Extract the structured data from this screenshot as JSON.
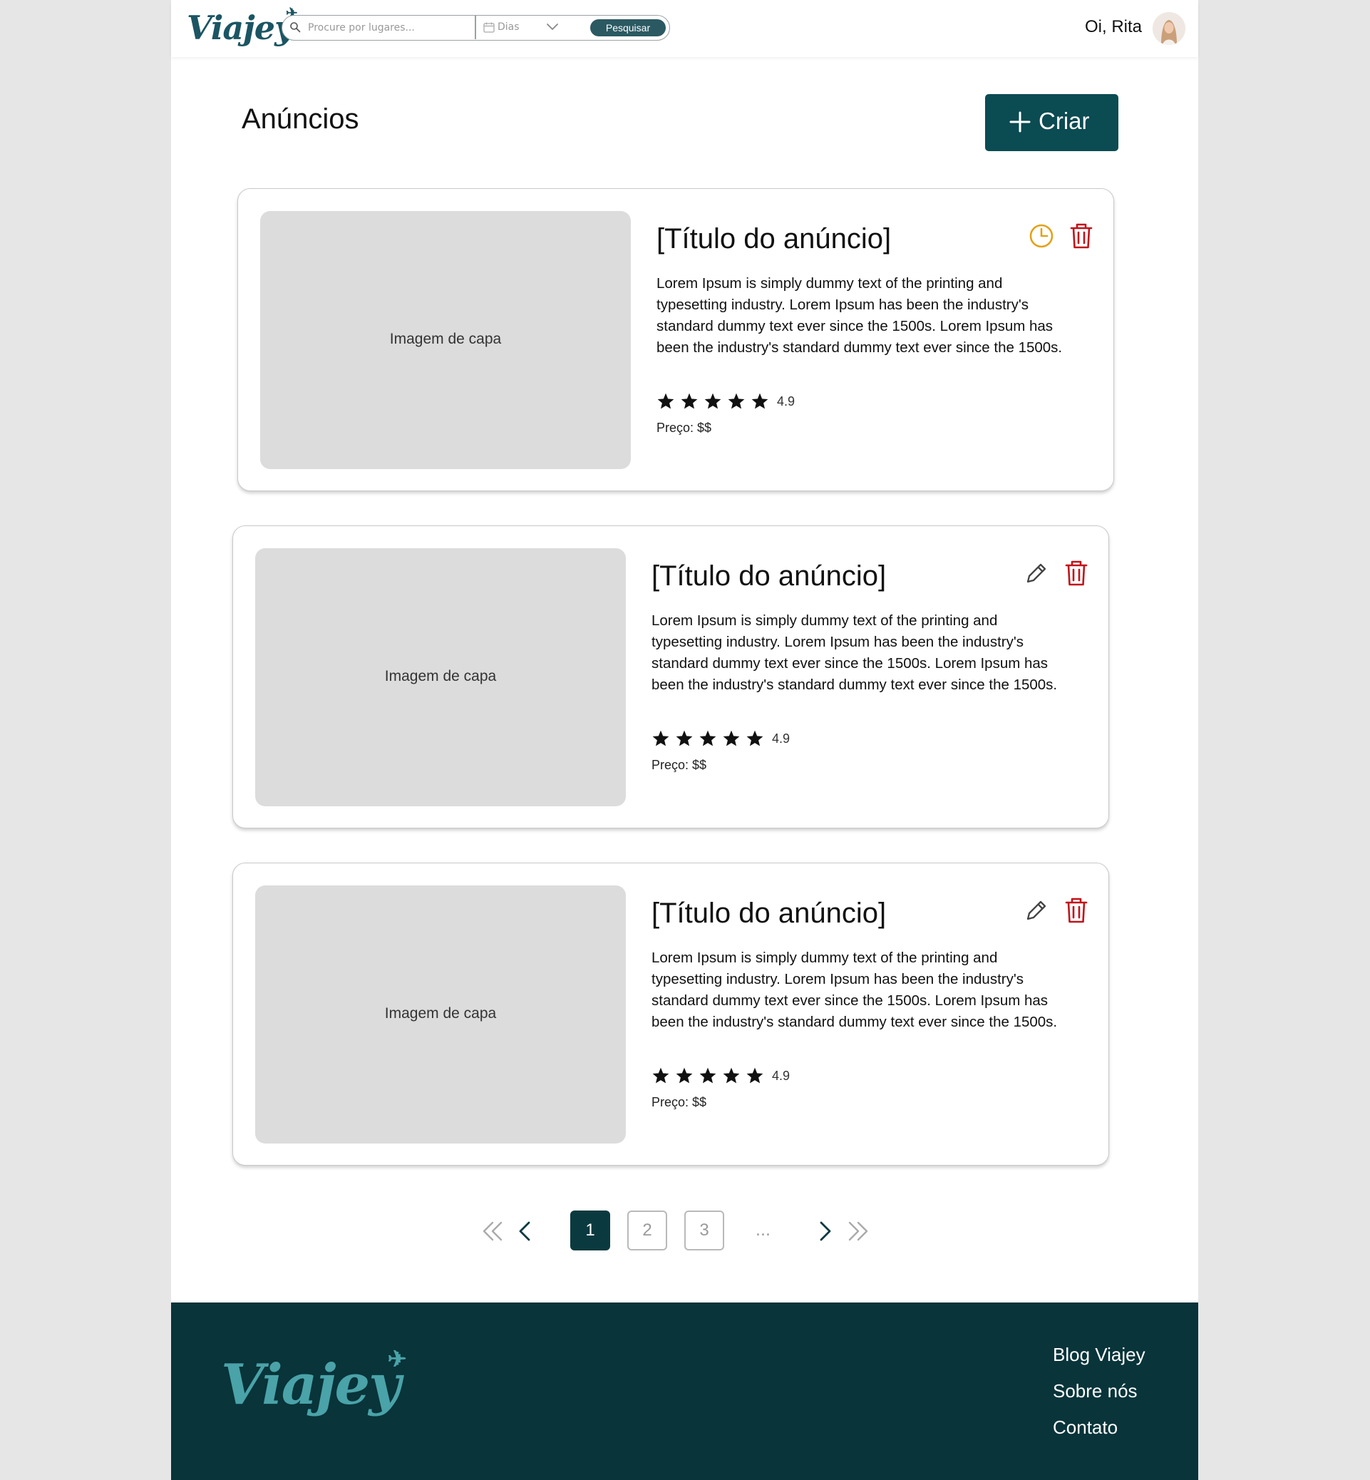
{
  "header": {
    "logo": "Viajey",
    "search_placeholder": "Procure por lugares...",
    "date_label": "Dias",
    "search_button": "Pesquisar",
    "greeting": "Oi, Rita"
  },
  "main": {
    "title": "Anúncios",
    "create_button": "Criar"
  },
  "cards": [
    {
      "cover_label": "Imagem de capa",
      "title": "[Título do anúncio]",
      "description": "Lorem Ipsum is simply dummy text of the printing and typesetting industry. Lorem Ipsum has been the industry's standard dummy text ever since the 1500s. Lorem Ipsum has been the industry's standard dummy text ever since the 1500s.",
      "rating": "4.9",
      "stars": 5,
      "price": "Preço: $$",
      "primary_action_icon": "clock-icon",
      "primary_action_color": "#e3a21a",
      "delete_color": "#c0141a"
    },
    {
      "cover_label": "Imagem de capa",
      "title": "[Título do anúncio]",
      "description": "Lorem Ipsum is simply dummy text of the printing and typesetting industry. Lorem Ipsum has been the industry's standard dummy text ever since the 1500s. Lorem Ipsum has been the industry's standard dummy text ever since the 1500s.",
      "rating": "4.9",
      "stars": 5,
      "price": "Preço: $$",
      "primary_action_icon": "pencil-icon",
      "primary_action_color": "#444444",
      "delete_color": "#c0141a"
    },
    {
      "cover_label": "Imagem de capa",
      "title": "[Título do anúncio]",
      "description": "Lorem Ipsum is simply dummy text of the printing and typesetting industry. Lorem Ipsum has been the industry's standard dummy text ever since the 1500s. Lorem Ipsum has been the industry's standard dummy text ever since the 1500s.",
      "rating": "4.9",
      "stars": 5,
      "price": "Preço: $$",
      "primary_action_icon": "pencil-icon",
      "primary_action_color": "#444444",
      "delete_color": "#c0141a"
    }
  ],
  "pagination": {
    "pages": [
      "1",
      "2",
      "3"
    ],
    "current": "1",
    "ellipsis": "..."
  },
  "footer": {
    "logo": "Viajey",
    "links": [
      "Blog Viajey",
      "Sobre nós",
      "Contato"
    ]
  },
  "colors": {
    "brand": "#0b4b52",
    "footer_bg": "#08343a",
    "active_page": "#0a3a3f"
  }
}
